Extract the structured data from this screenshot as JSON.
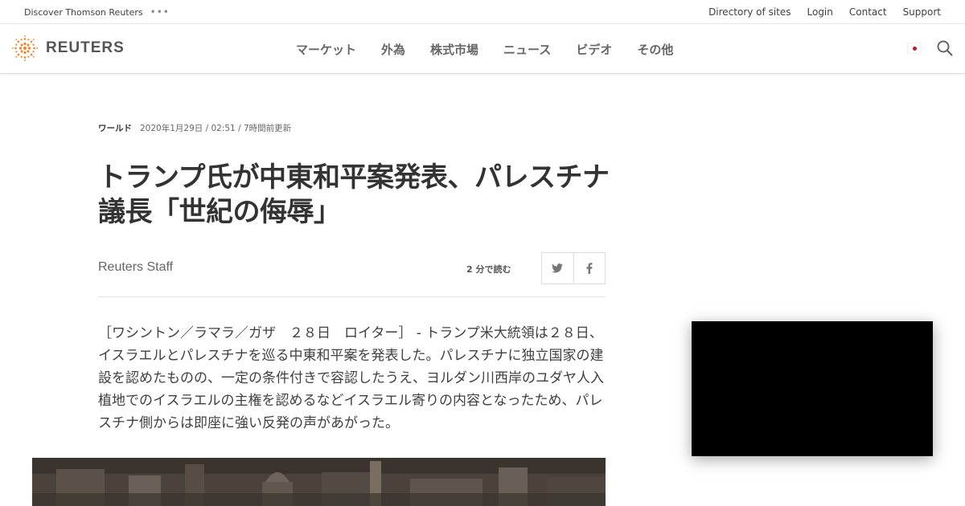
{
  "utility": {
    "discover": "Discover Thomson Reuters",
    "dots": "•••",
    "links": [
      "Directory of sites",
      "Login",
      "Contact",
      "Support"
    ]
  },
  "header": {
    "brand": "REUTERS",
    "nav": [
      "マーケット",
      "外為",
      "株式市場",
      "ニュース",
      "ビデオ",
      "その他"
    ],
    "icons": {
      "search": "search-icon",
      "flag": "japan-flag-icon"
    },
    "colors": {
      "brand_orange": "#f58220",
      "flag_red": "#c8102e"
    }
  },
  "article": {
    "section": "ワールド",
    "datetime": "2020年1月29日 / 02:51 / 7時間前更新",
    "headline": "トランプ氏が中東和平案発表、パレスチナ議長「世紀の侮辱」",
    "byline": "Reuters Staff",
    "read_time": "2  分で読む",
    "share": [
      "twitter-icon",
      "facebook-icon"
    ],
    "body": "［ワシントン／ラマラ／ガザ　２８日　ロイター］ - トランプ米大統領は２８日、イスラエルとパレスチナを巡る中東和平案を発表した。パレスチナに独立国家の建設を認めたものの、一定の条件付きで容認したうえ、ヨルダン川西岸のユダヤ人入植地でのイスラエルの主権を認めるなどイスラエル寄りの内容となったため、パレスチナ側からは即座に強い反発の声があがった。"
  }
}
